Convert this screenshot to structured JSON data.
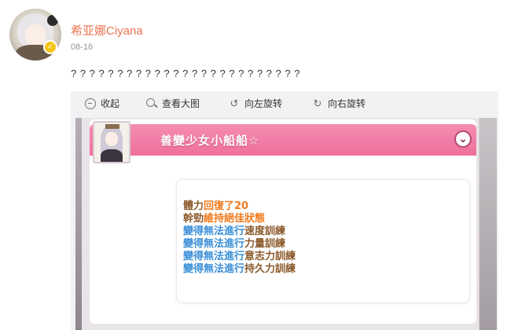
{
  "post": {
    "username": "希亚娜Ciyana",
    "date": "08-16",
    "text": "? ? ? ? ? ? ? ? ? ? ? ? ? ? ? ? ? ? ? ? ? ? ? ? ?"
  },
  "toolbar": {
    "collapse": "收起",
    "view_large": "查看大图",
    "rotate_left": "向左旋转",
    "rotate_right": "向右旋转"
  },
  "screenshot": {
    "title": "善變少女小船船☆",
    "messages": [
      {
        "parts": [
          {
            "text": "體力",
            "color": "brown"
          },
          {
            "text": "回復了20",
            "color": "orange"
          }
        ]
      },
      {
        "parts": [
          {
            "text": "幹勁",
            "color": "brown"
          },
          {
            "text": "維持絕佳狀態",
            "color": "orange"
          }
        ]
      },
      {
        "parts": [
          {
            "text": "變得無法進行",
            "color": "blue"
          },
          {
            "text": "速度訓練",
            "color": "brown"
          }
        ]
      },
      {
        "parts": [
          {
            "text": "變得無法進行",
            "color": "blue"
          },
          {
            "text": "力量訓練",
            "color": "brown"
          }
        ]
      },
      {
        "parts": [
          {
            "text": "變得無法進行",
            "color": "blue"
          },
          {
            "text": "意志力訓練",
            "color": "brown"
          }
        ]
      },
      {
        "parts": [
          {
            "text": "變得無法進行",
            "color": "blue"
          },
          {
            "text": "持久力訓練",
            "color": "brown"
          }
        ]
      }
    ]
  },
  "icons": [
    "collapse-icon",
    "search-icon",
    "rotate-left-icon",
    "rotate-right-icon",
    "chevron-down-icon"
  ],
  "colors": {
    "username": "#eb7350",
    "title_bar": "#ee6f9c",
    "brown": "#8b5a2b",
    "orange": "#f07a1d",
    "blue": "#3a8fd8"
  }
}
